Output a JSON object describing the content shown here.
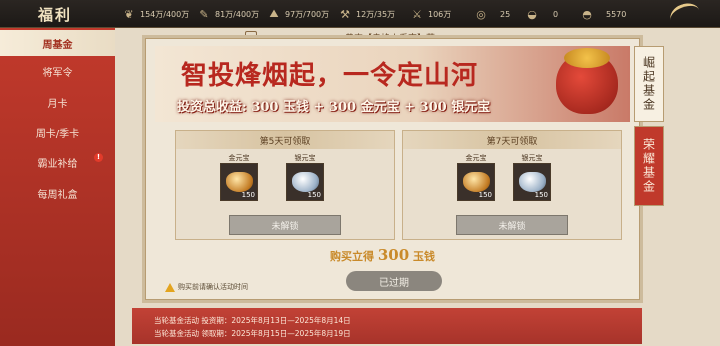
{
  "header": {
    "title": "福利",
    "resources": [
      {
        "icon": "grain-icon",
        "value": "154万/400万"
      },
      {
        "icon": "wood-icon",
        "value": "81万/400万"
      },
      {
        "icon": "stone-icon",
        "value": "97万/700万"
      },
      {
        "icon": "iron-icon",
        "value": "12万/35万"
      },
      {
        "icon": "troops-icon",
        "value": "106万"
      },
      {
        "icon": "coin-icon",
        "value": "25"
      },
      {
        "icon": "gold-ingot-icon",
        "value": "0"
      },
      {
        "icon": "silver-ingot-icon",
        "value": "5570"
      }
    ]
  },
  "sidebar": {
    "items": [
      {
        "label": "周基金",
        "active": true
      },
      {
        "label": "将军令"
      },
      {
        "label": "月卡"
      },
      {
        "label": "周卡/季卡"
      },
      {
        "label": "霸业补给",
        "badge": "!"
      },
      {
        "label": "每周礼盒"
      }
    ]
  },
  "main": {
    "congrats": "恭喜【赤焰丨乔克】获",
    "banner": {
      "title": "智投烽烟起，一令定山河",
      "subtitle": "投资总收益: 300 玉钱 + 300 金元宝 + 300 银元宝"
    },
    "tabs": [
      {
        "label": "崛起基金",
        "active": true
      },
      {
        "label": "荣耀基金",
        "active": false
      }
    ],
    "cards": [
      {
        "header": "第5天可领取",
        "items": [
          {
            "label": "金元宝",
            "type": "gold",
            "qty": "150"
          },
          {
            "label": "银元宝",
            "type": "silver",
            "qty": "150"
          }
        ],
        "button": "未解锁"
      },
      {
        "header": "第7天可领取",
        "items": [
          {
            "label": "金元宝",
            "type": "gold",
            "qty": "150"
          },
          {
            "label": "银元宝",
            "type": "silver",
            "qty": "150"
          }
        ],
        "button": "未解锁"
      }
    ],
    "buy": {
      "prefix": "购买立得",
      "amount": "300",
      "unit": "玉钱"
    },
    "expired_button": "已过期",
    "warning": "购买前请确认活动时间"
  },
  "info": {
    "invest_period": "当轮基金活动 投资期：2025年8月13日—2025年8月14日",
    "claim_period": "当轮基金活动 领取期：2025年8月15日—2025年8月19日"
  },
  "colors": {
    "accent_red": "#c23a2c",
    "banner_red": "#b8281f",
    "gold_text": "#c98a2a"
  }
}
